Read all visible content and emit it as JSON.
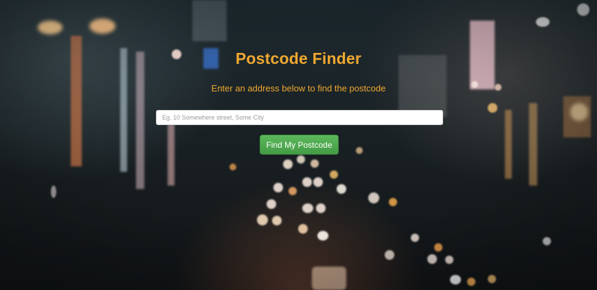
{
  "page": {
    "title": "Postcode Finder",
    "subtitle": "Enter an address below to find the postcode"
  },
  "search": {
    "placeholder": "Eg. 10 Somewhere street, Some City",
    "value": ""
  },
  "actions": {
    "find_label": "Find My Postcode"
  },
  "colors": {
    "accent": "#f0a830",
    "button": "#5cb85c",
    "button_text": "#ffffff"
  }
}
